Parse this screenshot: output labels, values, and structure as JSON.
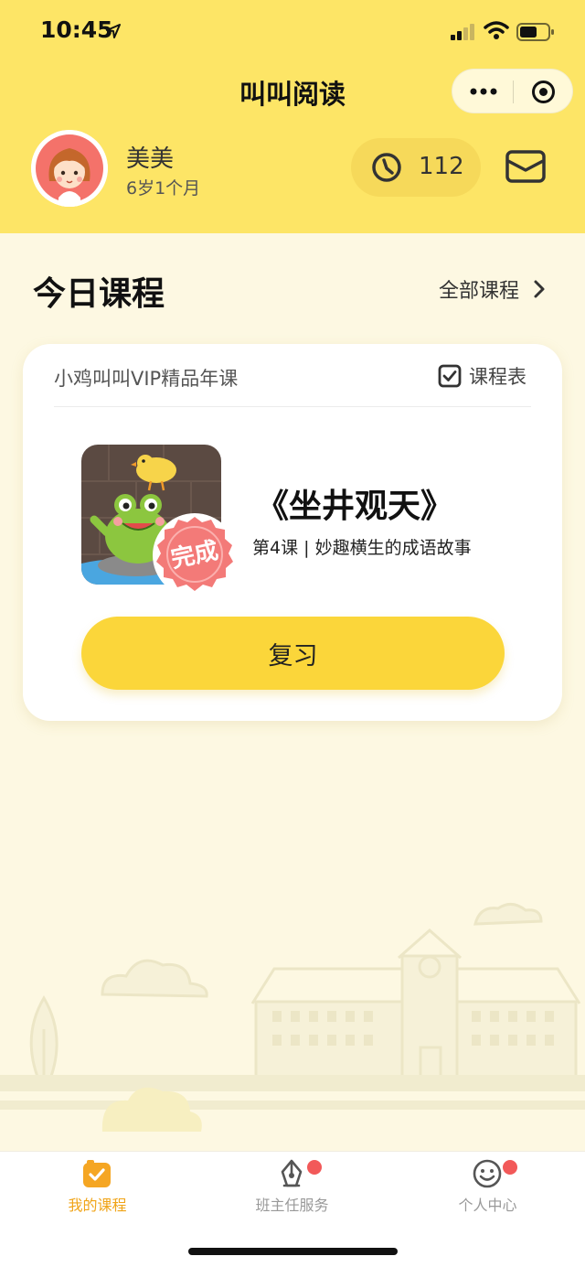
{
  "status_bar": {
    "time": "10:45",
    "icons": [
      "location-arrow-icon",
      "signal-icon",
      "wifi-icon",
      "battery-icon"
    ]
  },
  "app": {
    "title": "叫叫阅读",
    "capsule_icons": [
      "more-icon",
      "close-mini-program-icon"
    ]
  },
  "user": {
    "name": "美美",
    "age": "6岁1个月",
    "minutes": "112"
  },
  "today": {
    "section_title": "今日课程",
    "all_courses_label": "全部课程"
  },
  "course_card": {
    "course_name": "小鸡叫叫VIP精品年课",
    "schedule_label": "课程表",
    "lesson_title": "《坐井观天》",
    "lesson_subtitle": "第4课 | 妙趣横生的成语故事",
    "status_stamp": "完成",
    "review_button": "复习"
  },
  "tab_bar": {
    "tabs": [
      {
        "label": "我的课程",
        "icon": "my-courses-icon",
        "active": true,
        "badge": false
      },
      {
        "label": "班主任服务",
        "icon": "teacher-service-icon",
        "active": false,
        "badge": true
      },
      {
        "label": "个人中心",
        "icon": "profile-icon",
        "active": false,
        "badge": true
      }
    ]
  },
  "colors": {
    "header_bg": "#fde566",
    "page_bg": "#fdf8e2",
    "accent_button": "#fbd63a",
    "active_tab": "#f0a418",
    "stamp": "#f37a78",
    "badge": "#f25959"
  }
}
